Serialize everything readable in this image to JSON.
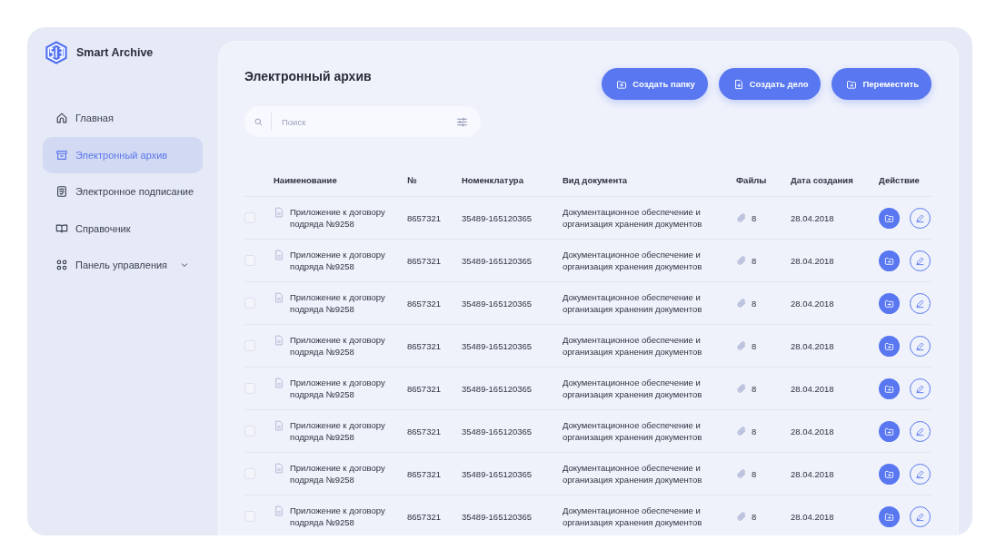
{
  "app": {
    "name": "Smart Archive"
  },
  "sidebar": {
    "items": [
      {
        "label": "Главная",
        "selected": false
      },
      {
        "label": "Электронный архив",
        "selected": true
      },
      {
        "label": "Электронное подписание",
        "selected": false
      },
      {
        "label": "Справочник",
        "selected": false
      },
      {
        "label": "Панель управления",
        "selected": false,
        "has_submenu": true
      }
    ]
  },
  "page": {
    "title": "Электронный архив"
  },
  "actions": [
    {
      "label": "Создать папку"
    },
    {
      "label": "Создать дело"
    },
    {
      "label": "Переместить"
    }
  ],
  "search": {
    "placeholder": "Поиск"
  },
  "table": {
    "columns": [
      "Наименование",
      "№",
      "Номенклатура",
      "Вид документа",
      "Файлы",
      "Дата создания",
      "Действие"
    ],
    "rows": [
      {
        "checked": false,
        "name": "Приложение к договору подряда №9258",
        "number": "8657321",
        "nomenclature": "35489-165120365",
        "doc_type": "Документационное обеспечение и организация хранения документов",
        "files": "8",
        "date": "28.04.2018"
      },
      {
        "checked": false,
        "name": "Приложение к договору подряда №9258",
        "number": "8657321",
        "nomenclature": "35489-165120365",
        "doc_type": "Документационное обеспечение и организация хранения документов",
        "files": "8",
        "date": "28.04.2018"
      },
      {
        "checked": false,
        "name": "Приложение к договору подряда №9258",
        "number": "8657321",
        "nomenclature": "35489-165120365",
        "doc_type": "Документационное обеспечение и организация хранения документов",
        "files": "8",
        "date": "28.04.2018"
      },
      {
        "checked": false,
        "name": "Приложение к договору подряда №9258",
        "number": "8657321",
        "nomenclature": "35489-165120365",
        "doc_type": "Документационное обеспечение и организация хранения документов",
        "files": "8",
        "date": "28.04.2018"
      },
      {
        "checked": false,
        "name": "Приложение к договору подряда №9258",
        "number": "8657321",
        "nomenclature": "35489-165120365",
        "doc_type": "Документационное обеспечение и организация хранения документов",
        "files": "8",
        "date": "28.04.2018"
      },
      {
        "checked": false,
        "name": "Приложение к договору подряда №9258",
        "number": "8657321",
        "nomenclature": "35489-165120365",
        "doc_type": "Документационное обеспечение и организация хранения документов",
        "files": "8",
        "date": "28.04.2018"
      },
      {
        "checked": false,
        "name": "Приложение к договору подряда №9258",
        "number": "8657321",
        "nomenclature": "35489-165120365",
        "doc_type": "Документационное обеспечение и организация хранения документов",
        "files": "8",
        "date": "28.04.2018"
      },
      {
        "checked": false,
        "name": "Приложение к договору подряда №9258",
        "number": "8657321",
        "nomenclature": "35489-165120365",
        "doc_type": "Документационное обеспечение и организация хранения документов",
        "files": "8",
        "date": "28.04.2018"
      }
    ]
  }
}
